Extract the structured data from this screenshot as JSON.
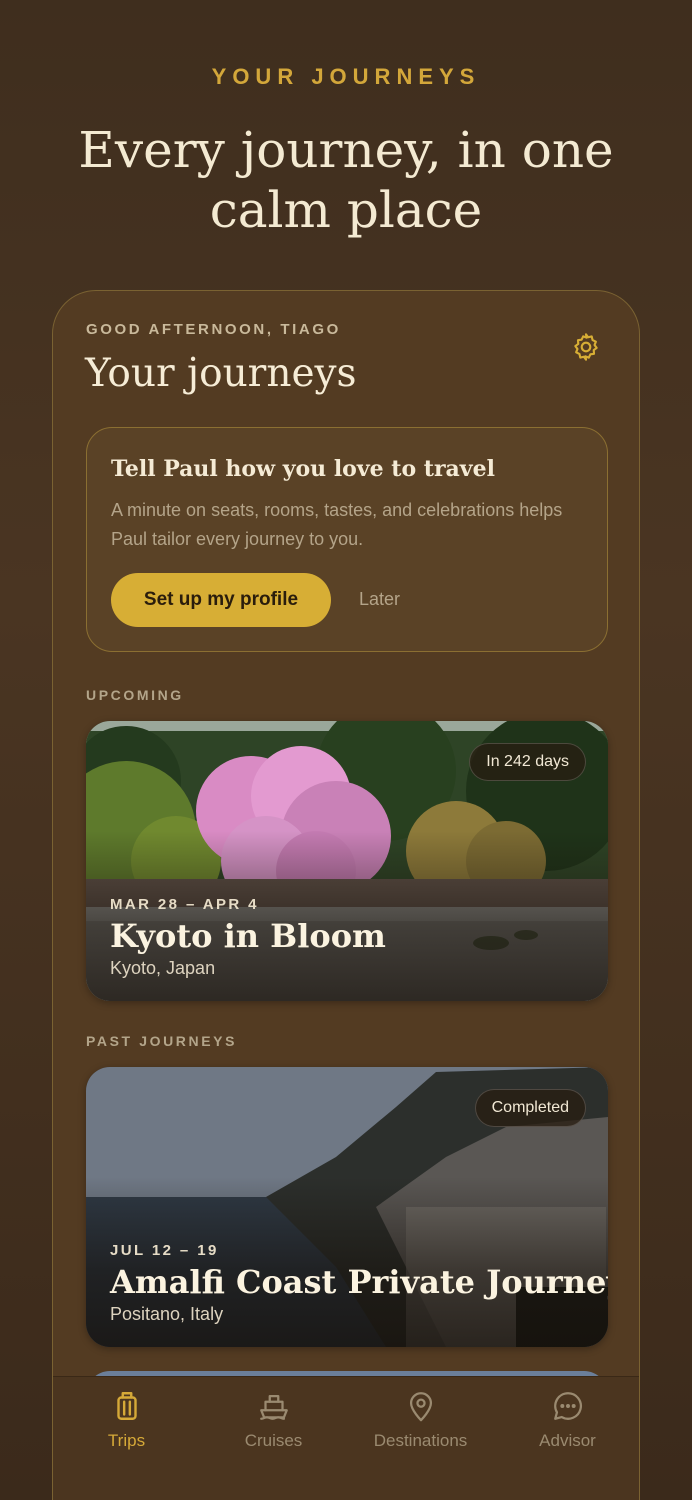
{
  "header": {
    "eyebrow": "YOUR JOURNEYS",
    "title": "Every journey, in one calm place"
  },
  "screen": {
    "greeting": "GOOD AFTERNOON, TIAGO",
    "title": "Your journeys",
    "settings_icon": "gear-icon"
  },
  "profile_prompt": {
    "title": "Tell Paul how you love to travel",
    "description": "A minute on seats, rooms, tastes, and celebrations helps Paul tailor every journey to you.",
    "primary_label": "Set up my profile",
    "secondary_label": "Later"
  },
  "sections": {
    "upcoming_label": "UPCOMING",
    "past_label": "PAST JOURNEYS"
  },
  "trips": {
    "upcoming": [
      {
        "badge": "In 242 days",
        "dates": "MAR 28 – APR 4",
        "name": "Kyoto in Bloom",
        "place": "Kyoto, Japan"
      }
    ],
    "past": [
      {
        "badge": "Completed",
        "dates": "JUL 12 – 19",
        "name": "Amalfi Coast Private Journey",
        "place": "Positano, Italy"
      }
    ]
  },
  "tabbar": {
    "items": [
      {
        "label": "Trips",
        "icon": "suitcase-icon",
        "active": true
      },
      {
        "label": "Cruises",
        "icon": "ship-icon",
        "active": false
      },
      {
        "label": "Destinations",
        "icon": "map-pin-icon",
        "active": false
      },
      {
        "label": "Advisor",
        "icon": "chat-bubble-icon",
        "active": false
      }
    ]
  },
  "colors": {
    "accent": "#d7ae35",
    "background": "#4a3522",
    "text_primary": "#f4ead2",
    "text_muted": "#b4a489"
  }
}
